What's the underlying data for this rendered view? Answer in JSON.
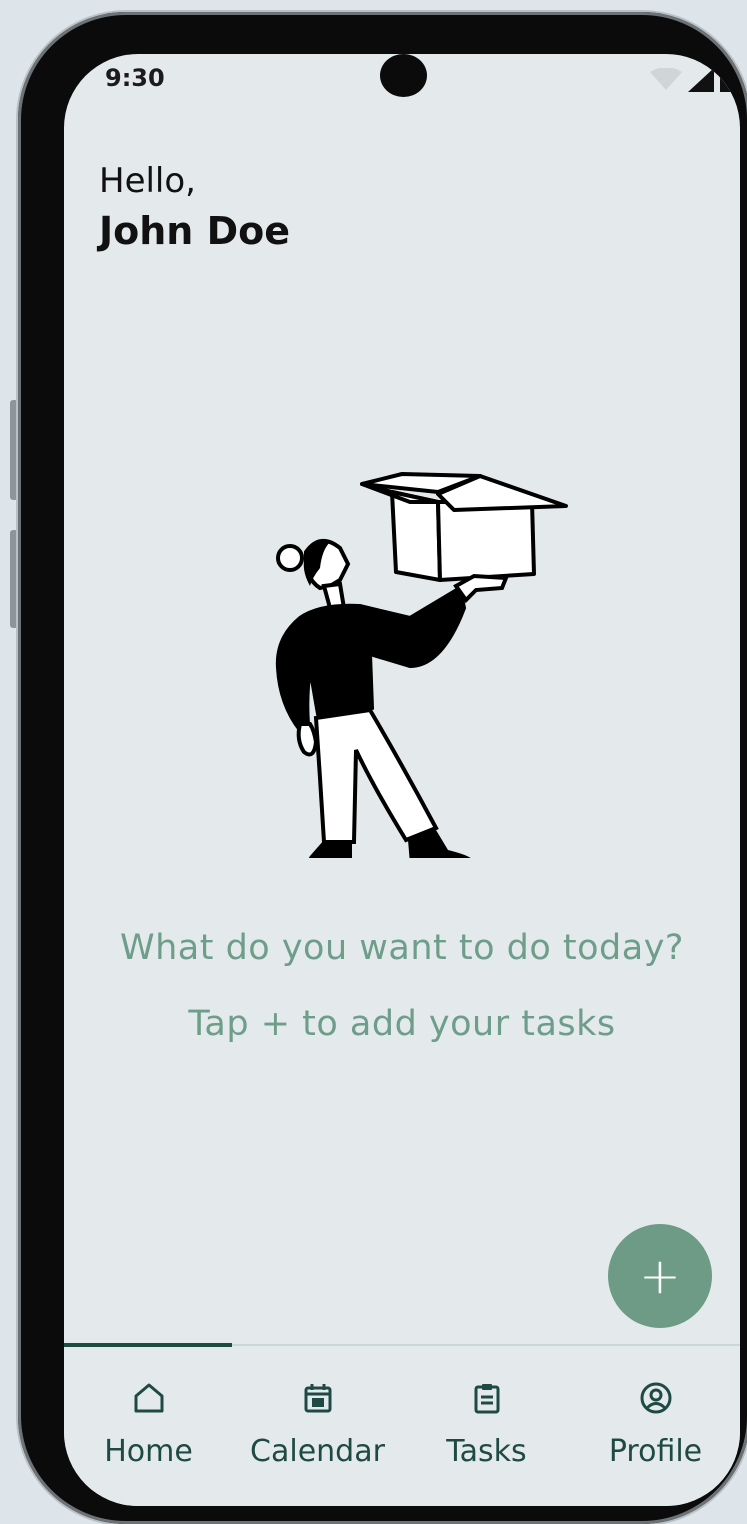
{
  "status_bar": {
    "time": "9:30"
  },
  "greeting": {
    "hello": "Hello,",
    "name": "John Doe"
  },
  "empty_state": {
    "prompt": "What do you want to do today?",
    "hint": "Tap + to add your tasks"
  },
  "fab": {
    "label": "+"
  },
  "nav": {
    "items": [
      {
        "label": "Home",
        "icon": "home-icon",
        "active": true
      },
      {
        "label": "Calendar",
        "icon": "calendar-icon",
        "active": false
      },
      {
        "label": "Tasks",
        "icon": "clipboard-icon",
        "active": false
      },
      {
        "label": "Profile",
        "icon": "profile-icon",
        "active": false
      }
    ]
  },
  "colors": {
    "accent": "#6d9b86",
    "nav_active": "#1f4c40",
    "text_muted": "#6e9e8a",
    "screen_bg": "#e4eaeb"
  }
}
